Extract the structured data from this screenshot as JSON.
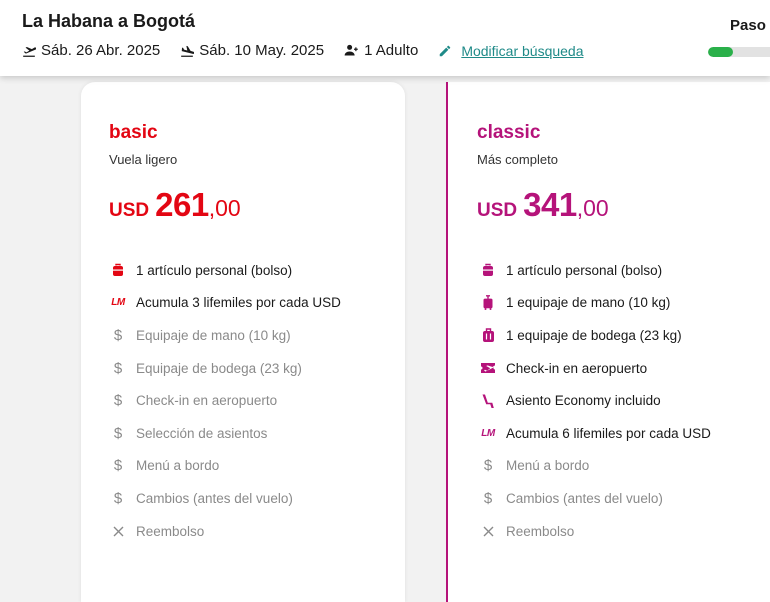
{
  "header": {
    "route": "La Habana a Bogotá",
    "departure_date": "Sáb. 26 Abr. 2025",
    "return_date": "Sáb. 10 May. 2025",
    "passengers": "1 Adulto",
    "modify_label": "Modificar búsqueda",
    "step_label": "Paso",
    "progress_fraction": 0.4
  },
  "colors": {
    "basic_accent": "#e30613",
    "classic_accent": "#b5137a",
    "link": "#1f8a88",
    "progress": "#2ab04a",
    "excluded": "#8a8a8a"
  },
  "plans": [
    {
      "name": "basic",
      "subtitle": "Vuela ligero",
      "currency": "USD",
      "price_int": "261",
      "price_dec": ",00",
      "features": [
        {
          "icon": "personal-bag-icon",
          "label": "1 artículo personal (bolso)",
          "included": true
        },
        {
          "icon": "lifemiles-icon",
          "label": "Acumula 3 lifemiles por cada USD",
          "included": true
        },
        {
          "icon": "dollar-icon",
          "label": "Equipaje de mano (10 kg)",
          "included": false
        },
        {
          "icon": "dollar-icon",
          "label": "Equipaje de bodega (23 kg)",
          "included": false
        },
        {
          "icon": "dollar-icon",
          "label": "Check-in en aeropuerto",
          "included": false
        },
        {
          "icon": "dollar-icon",
          "label": "Selección de asientos",
          "included": false
        },
        {
          "icon": "dollar-icon",
          "label": "Menú a bordo",
          "included": false
        },
        {
          "icon": "dollar-icon",
          "label": "Cambios (antes del vuelo)",
          "included": false
        },
        {
          "icon": "close-icon",
          "label": "Reembolso",
          "included": false
        }
      ]
    },
    {
      "name": "classic",
      "subtitle": "Más completo",
      "currency": "USD",
      "price_int": "341",
      "price_dec": ",00",
      "features": [
        {
          "icon": "personal-bag-icon",
          "label": "1 artículo personal (bolso)",
          "included": true
        },
        {
          "icon": "carry-on-icon",
          "label": "1 equipaje de mano (10 kg)",
          "included": true
        },
        {
          "icon": "checked-bag-icon",
          "label": "1 equipaje de bodega (23 kg)",
          "included": true
        },
        {
          "icon": "boarding-pass-icon",
          "label": "Check-in en aeropuerto",
          "included": true
        },
        {
          "icon": "seat-icon",
          "label": "Asiento Economy incluido",
          "included": true
        },
        {
          "icon": "lifemiles-icon",
          "label": "Acumula 6 lifemiles por cada USD",
          "included": true
        },
        {
          "icon": "dollar-icon",
          "label": "Menú a bordo",
          "included": false
        },
        {
          "icon": "dollar-icon",
          "label": "Cambios (antes del vuelo)",
          "included": false
        },
        {
          "icon": "close-icon",
          "label": "Reembolso",
          "included": false
        }
      ]
    }
  ]
}
